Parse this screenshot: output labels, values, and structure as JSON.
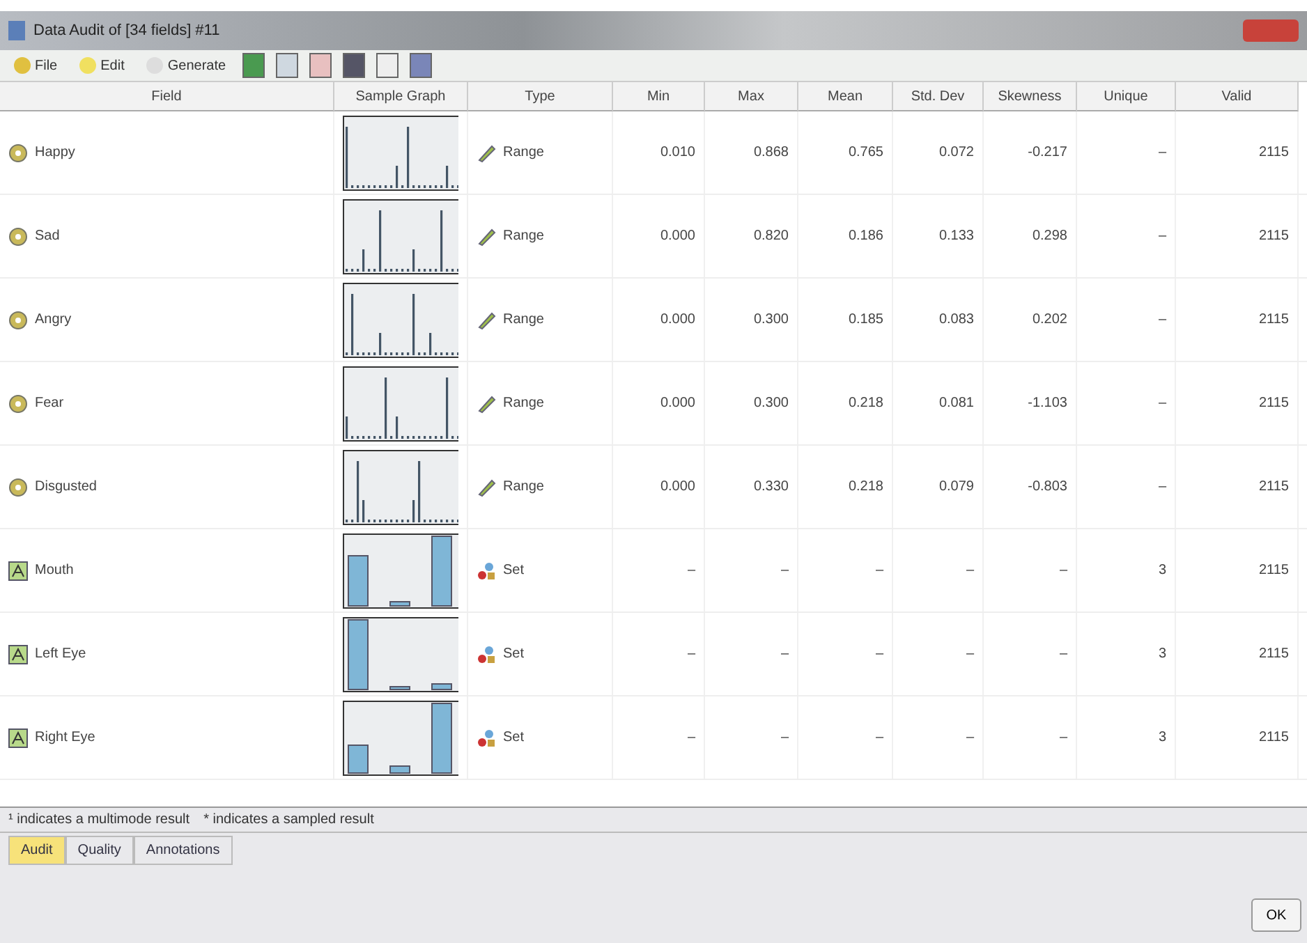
{
  "window": {
    "title": "Data Audit of [34 fields] #11"
  },
  "toolbar": {
    "menus": [
      "File",
      "Edit",
      "Generate"
    ]
  },
  "table": {
    "columns": [
      "Field",
      "Sample Graph",
      "Type",
      "Min",
      "Max",
      "Mean",
      "Std. Dev",
      "Skewness",
      "Unique",
      "Valid"
    ],
    "rows": [
      {
        "field": "Happy",
        "kind": "range",
        "type": "Range",
        "min": "0.010",
        "max": "0.868",
        "mean": "0.765",
        "std_dev": "0.072",
        "skewness": "-0.217",
        "unique": "–",
        "valid": "2115"
      },
      {
        "field": "Sad",
        "kind": "range",
        "type": "Range",
        "min": "0.000",
        "max": "0.820",
        "mean": "0.186",
        "std_dev": "0.133",
        "skewness": "0.298",
        "unique": "–",
        "valid": "2115"
      },
      {
        "field": "Angry",
        "kind": "range",
        "type": "Range",
        "min": "0.000",
        "max": "0.300",
        "mean": "0.185",
        "std_dev": "0.083",
        "skewness": "0.202",
        "unique": "–",
        "valid": "2115"
      },
      {
        "field": "Fear",
        "kind": "range",
        "type": "Range",
        "min": "0.000",
        "max": "0.300",
        "mean": "0.218",
        "std_dev": "0.081",
        "skewness": "-1.103",
        "unique": "–",
        "valid": "2115"
      },
      {
        "field": "Disgusted",
        "kind": "range",
        "type": "Range",
        "min": "0.000",
        "max": "0.330",
        "mean": "0.218",
        "std_dev": "0.079",
        "skewness": "-0.803",
        "unique": "–",
        "valid": "2115"
      },
      {
        "field": "Mouth",
        "kind": "set",
        "type": "Set",
        "min": "–",
        "max": "–",
        "mean": "–",
        "std_dev": "–",
        "skewness": "–",
        "unique": "3",
        "valid": "2115"
      },
      {
        "field": "Left Eye",
        "kind": "set",
        "type": "Set",
        "min": "–",
        "max": "–",
        "mean": "–",
        "std_dev": "–",
        "skewness": "–",
        "unique": "3",
        "valid": "2115"
      },
      {
        "field": "Right Eye",
        "kind": "set",
        "type": "Set",
        "min": "–",
        "max": "–",
        "mean": "–",
        "std_dev": "–",
        "skewness": "–",
        "unique": "3",
        "valid": "2115"
      }
    ]
  },
  "footnotes": [
    "¹ indicates a multimode result",
    "* indicates a sampled result"
  ],
  "tabs": [
    {
      "label": "Audit",
      "selected": true
    },
    {
      "label": "Quality",
      "selected": false
    },
    {
      "label": "Annotations",
      "selected": false
    }
  ],
  "buttons": [
    "OK"
  ]
}
